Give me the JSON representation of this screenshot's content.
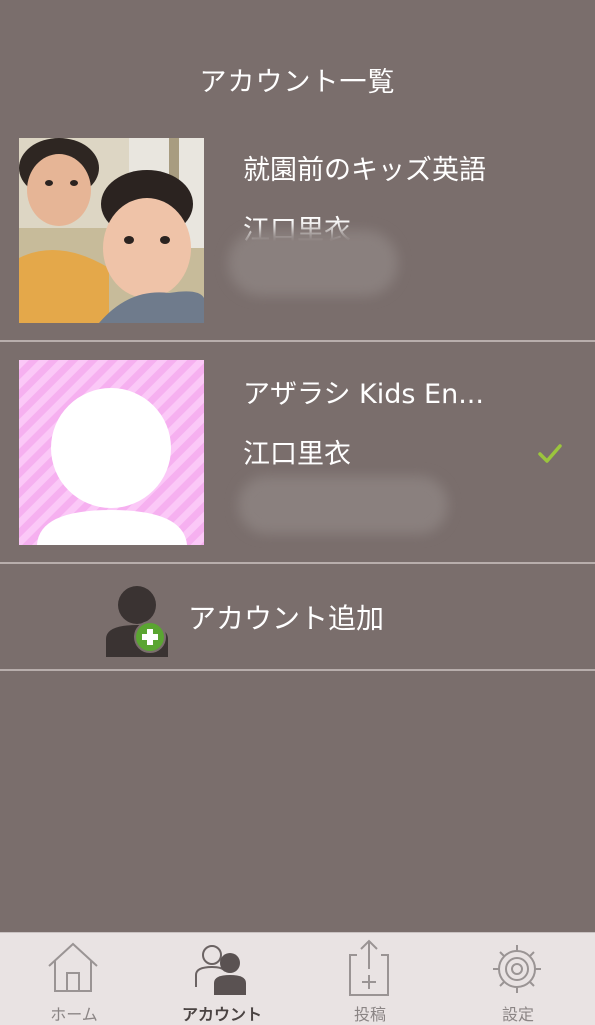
{
  "header": {
    "title": "アカウント一覧"
  },
  "accounts": [
    {
      "name": "就園前のキッズ英語",
      "user": "江口里衣",
      "selected": false,
      "avatar_icon": "photo-avatar"
    },
    {
      "name": "アザラシ Kids En...",
      "user": "江口里衣",
      "selected": true,
      "avatar_icon": "default-avatar"
    }
  ],
  "add_account": {
    "label": "アカウント追加",
    "icon": "add-user-icon"
  },
  "tabbar": {
    "tabs": [
      {
        "label": "ホーム",
        "icon": "home-icon",
        "active": false
      },
      {
        "label": "アカウント",
        "icon": "account-icon",
        "active": true
      },
      {
        "label": "投稿",
        "icon": "post-icon",
        "active": false
      },
      {
        "label": "設定",
        "icon": "settings-icon",
        "active": false
      }
    ]
  },
  "colors": {
    "background": "#7a6e6c",
    "divider": "#b8aeac",
    "check": "#9bc53d",
    "tabbar": "#e9e3e3",
    "default_avatar_bg": "#f8b4f2",
    "add_badge": "#5aa531"
  }
}
